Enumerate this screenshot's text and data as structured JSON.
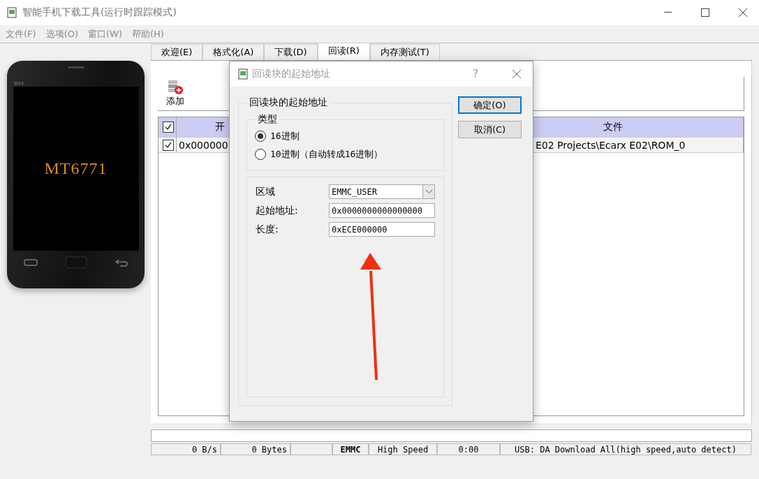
{
  "window": {
    "title": "智能手机下载工具(运行时跟踪模式)"
  },
  "menu": [
    "文件(F)",
    "选项(O)",
    "窗口(W)",
    "帮助(H)"
  ],
  "phone": {
    "brand": "BM",
    "chip": "MT6771"
  },
  "tabs": [
    {
      "label": "欢迎(E)",
      "selected": false
    },
    {
      "label": "格式化(A)",
      "selected": false
    },
    {
      "label": "下载(D)",
      "selected": false
    },
    {
      "label": "回读(R)",
      "selected": true
    },
    {
      "label": "内存测试(T)",
      "selected": false
    }
  ],
  "toolbar": {
    "add": "添加"
  },
  "table": {
    "header_checked": true,
    "columns": [
      "开",
      "文件"
    ],
    "rows": [
      {
        "checked": true,
        "cells": [
          "0x000000",
          "E02 Projects\\Ecarx E02\\ROM_0"
        ]
      }
    ]
  },
  "status_bar": [
    "0 B/s",
    "0 Bytes",
    "EMMC",
    "High Speed",
    "0:00",
    "USB: DA Download All(high speed,auto detect)"
  ],
  "dialog": {
    "title": "回读块的起始地址",
    "help": "?",
    "group": "回读块的起始地址",
    "type_group": "类型",
    "radios": [
      {
        "label": "16进制",
        "selected": true
      },
      {
        "label": "10进制（自动转成16进制）",
        "selected": false
      }
    ],
    "region": {
      "label": "区域",
      "value": "EMMC_USER"
    },
    "start": {
      "label": "起始地址:",
      "value": "0x0000000000000000"
    },
    "length": {
      "label": "长度:",
      "value": "0xECE000000"
    },
    "buttons": [
      {
        "label": "确定(O)",
        "default": true
      },
      {
        "label": "取消(C)",
        "default": false
      }
    ]
  }
}
